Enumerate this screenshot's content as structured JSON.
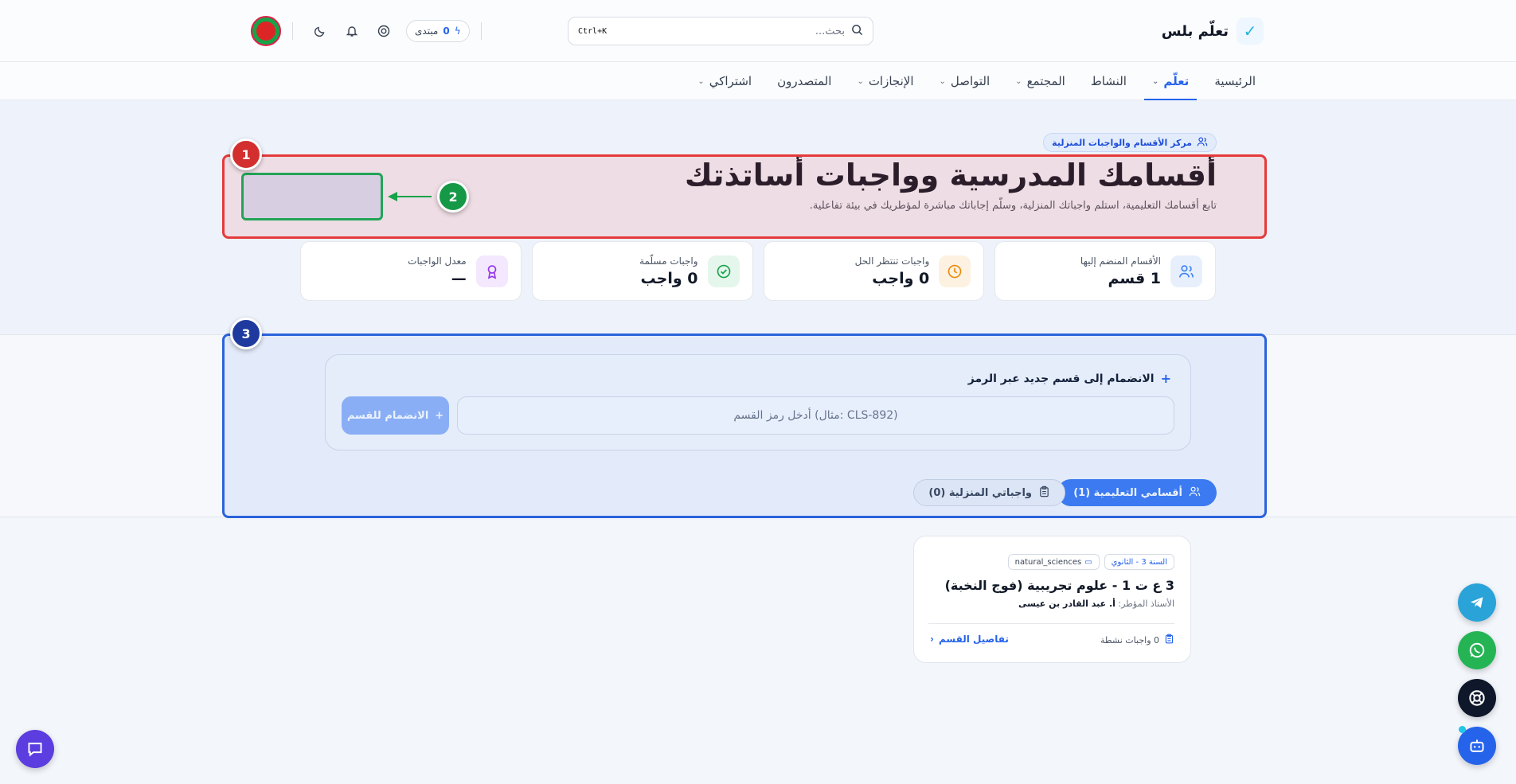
{
  "header": {
    "brand_name": "تعلّم بلس",
    "brand_icon": "brand-logo-icon",
    "search_placeholder": "بحث...",
    "search_shortcut": "Ctrl+K",
    "forum_label": "مبتدى",
    "forum_count": "0",
    "icons": [
      "help-ring-icon",
      "bell-icon",
      "moon-icon"
    ]
  },
  "nav": {
    "items": [
      {
        "label": "الرئيسية",
        "dropdown": false,
        "active": false
      },
      {
        "label": "تعلّم",
        "dropdown": true,
        "active": true
      },
      {
        "label": "النشاط",
        "dropdown": false,
        "active": false
      },
      {
        "label": "المجتمع",
        "dropdown": true,
        "active": false
      },
      {
        "label": "التواصل",
        "dropdown": true,
        "active": false
      },
      {
        "label": "الإنجازات",
        "dropdown": true,
        "active": false
      },
      {
        "label": "المتصدرون",
        "dropdown": false,
        "active": false
      },
      {
        "label": "اشتراكي",
        "dropdown": true,
        "active": false
      }
    ]
  },
  "hero": {
    "badge": "مركز الأقسام والواجبات المنزلية",
    "title": "أقسامك المدرسية وواجبات أساتذتك",
    "subtitle": "تابع أقسامك التعليمية، استلم واجباتك المنزلية، وسلّم إجاباتك مباشرة لمؤطريك في بيئة تفاعلية."
  },
  "annotations": {
    "one": "1",
    "two": "2",
    "three": "3"
  },
  "stats": [
    {
      "label": "الأقسام المنضم إليها",
      "value": "1 قسم",
      "icon": "users-icon",
      "color": "#3b82f6",
      "bg": "#e8effc"
    },
    {
      "label": "واجبات تنتظر الحل",
      "value": "0 واجب",
      "icon": "clock-icon",
      "color": "#ea8a0c",
      "bg": "#fdf1e1"
    },
    {
      "label": "واجبات مسلّمة",
      "value": "0 واجب",
      "icon": "check-circle-icon",
      "color": "#16a34a",
      "bg": "#e5f6ec"
    },
    {
      "label": "معدل الواجبات",
      "value": "—",
      "icon": "award-icon",
      "color": "#9333ea",
      "bg": "#f3e8fd"
    }
  ],
  "join": {
    "title": "الانضمام إلى قسم جديد عبر الرمز",
    "input_placeholder": "(CLS-892 :مثال) أدخل رمز القسم",
    "button_label": "الانضمام للقسم"
  },
  "tabs": {
    "classes": "أقسامي التعليمية (1)",
    "homework": "واجباتي المنزلية (0)"
  },
  "class_card": {
    "tag_year": "السنة 3 - الثانوي",
    "tag_subject": "natural_sciences",
    "title": "3 ع ت 1 - علوم تجريبية (فوج النخبة)",
    "teacher_prefix": "الأستاذ المؤطر:",
    "teacher_name": "أ. عبد القادر بن عيسى",
    "homework_count": "0 واجبات نشطة",
    "details_link": "تفاصيل القسم"
  },
  "colors": {
    "accent": "#2563eb",
    "annotation_red": "#e53a3a",
    "annotation_green": "#22a456",
    "annotation_blue": "#2b63dc"
  }
}
